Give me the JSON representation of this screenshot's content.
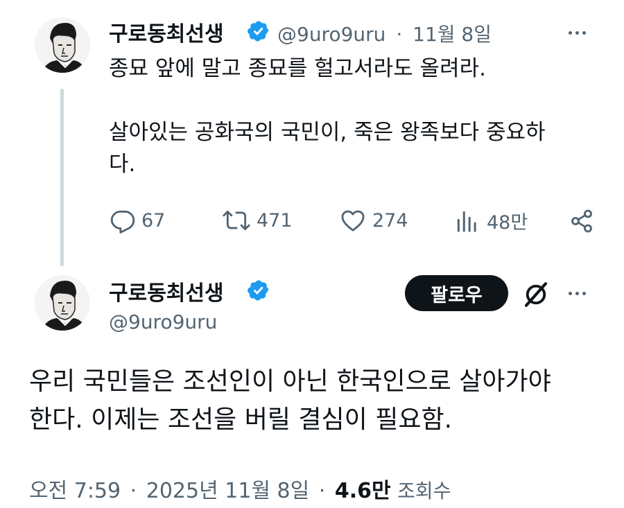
{
  "reply_tweet": {
    "display_name": "구로동최선생",
    "handle": "@9uro9uru",
    "separator": "·",
    "date": "11월 8일",
    "line1": "종묘 앞에 말고 종묘를 헐고서라도 올려라.",
    "line2": "살아있는 공화국의 국민이, 죽은 왕족보다 중요하",
    "line3": "다.",
    "replies": "67",
    "retweets": "471",
    "likes": "274",
    "views": "48만"
  },
  "main_tweet": {
    "display_name": "구로동최선생",
    "handle": "@9uro9uru",
    "follow_label": "팔로우",
    "line1": "우리 국민들은 조선인이 아닌 한국인으로 살아가야",
    "line2": "한다. 이제는 조선을 버릴 결심이 필요함.",
    "time": "오전 7:59",
    "separator1": "·",
    "full_date": "2025년 11월 8일",
    "separator2": "·",
    "view_count": "4.6만",
    "view_label": "조회수"
  },
  "icons": {
    "verified": "verified-badge-icon",
    "reply": "reply-icon",
    "retweet": "retweet-icon",
    "like": "heart-icon",
    "views": "analytics-icon",
    "share": "share-icon",
    "more": "more-icon",
    "grok": "grok-icon"
  },
  "colors": {
    "text": "#0f1419",
    "muted": "#536471",
    "verified": "#1d9bf0",
    "thread_line": "#cfd9de",
    "follow_bg": "#0f1419"
  }
}
